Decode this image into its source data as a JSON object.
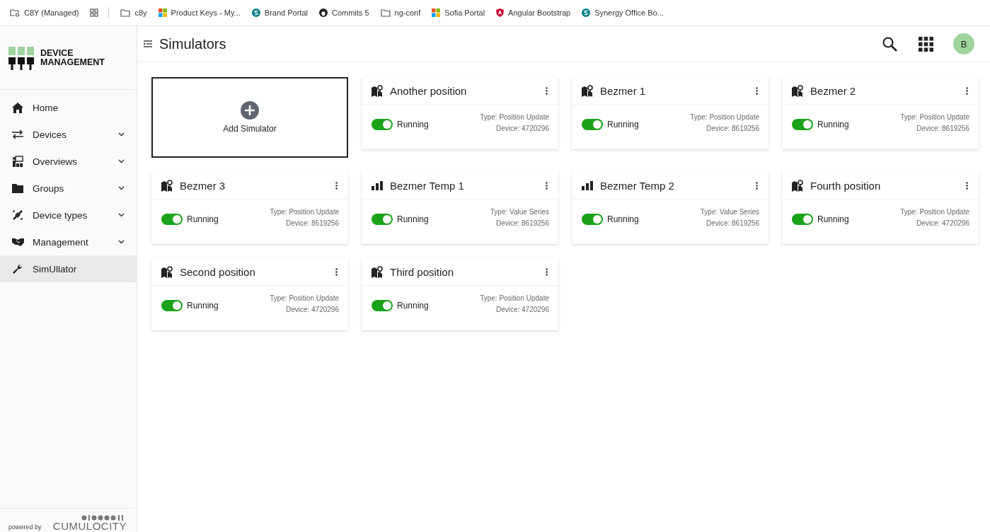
{
  "bookmarks": [
    {
      "kind": "managed",
      "label": "C8Y (Managed)"
    },
    {
      "kind": "apps"
    },
    {
      "kind": "folder",
      "label": "c8y"
    },
    {
      "kind": "windows",
      "label": "Product Keys - My..."
    },
    {
      "kind": "sharepoint",
      "label": "Brand Portal"
    },
    {
      "kind": "github",
      "label": "Commits 5"
    },
    {
      "kind": "folder",
      "label": "ng-conf"
    },
    {
      "kind": "windows",
      "label": "Sofia Portal"
    },
    {
      "kind": "angular",
      "label": "Angular Bootstrap"
    },
    {
      "kind": "sharepoint",
      "label": "Synergy Office Bo..."
    }
  ],
  "sidebar": {
    "brand": [
      "DEVICE",
      "MANAGEMENT"
    ],
    "items": [
      {
        "kind": "home",
        "label": "Home",
        "expandable": false,
        "selected": false
      },
      {
        "kind": "arrows",
        "label": "Devices",
        "expandable": true,
        "selected": false
      },
      {
        "kind": "overview",
        "label": "Overviews",
        "expandable": true,
        "selected": false
      },
      {
        "kind": "folder",
        "label": "Groups",
        "expandable": true,
        "selected": false
      },
      {
        "kind": "plug",
        "label": "Device types",
        "expandable": true,
        "selected": false
      },
      {
        "kind": "handshake",
        "label": "Management",
        "expandable": true,
        "selected": false
      },
      {
        "kind": "wrench",
        "label": "SimUllator",
        "expandable": false,
        "selected": true
      }
    ],
    "footer": {
      "powered": "powered by",
      "brand": "CUMULOCITY"
    }
  },
  "header": {
    "title": "Simulators",
    "avatar": "B"
  },
  "add_card": {
    "label": "Add Simulator"
  },
  "simulators": [
    {
      "kind": "position",
      "name": "Another position",
      "running": true,
      "status": "Running",
      "type": "Type: Position Update",
      "device": "Device: 4720296"
    },
    {
      "kind": "position",
      "name": "Bezmer 1",
      "running": true,
      "status": "Running",
      "type": "Type: Position Update",
      "device": "Device: 8619256"
    },
    {
      "kind": "position",
      "name": "Bezmer 2",
      "running": true,
      "status": "Running",
      "type": "Type: Position Update",
      "device": "Device: 8619256"
    },
    {
      "kind": "position",
      "name": "Bezmer 3",
      "running": true,
      "status": "Running",
      "type": "Type: Position Update",
      "device": "Device: 8619256"
    },
    {
      "kind": "series",
      "name": "Bezmer Temp 1",
      "running": true,
      "status": "Running",
      "type": "Type: Value Series",
      "device": "Device: 8619256"
    },
    {
      "kind": "series",
      "name": "Bezmer Temp 2",
      "running": true,
      "status": "Running",
      "type": "Type: Value Series",
      "device": "Device: 8619256"
    },
    {
      "kind": "position",
      "name": "Fourth position",
      "running": true,
      "status": "Running",
      "type": "Type: Position Update",
      "device": "Device: 4720296"
    },
    {
      "kind": "position",
      "name": "Second position",
      "running": true,
      "status": "Running",
      "type": "Type: Position Update",
      "device": "Device: 4720296"
    },
    {
      "kind": "position",
      "name": "Third position",
      "running": true,
      "status": "Running",
      "type": "Type: Position Update",
      "device": "Device: 4720296"
    }
  ]
}
